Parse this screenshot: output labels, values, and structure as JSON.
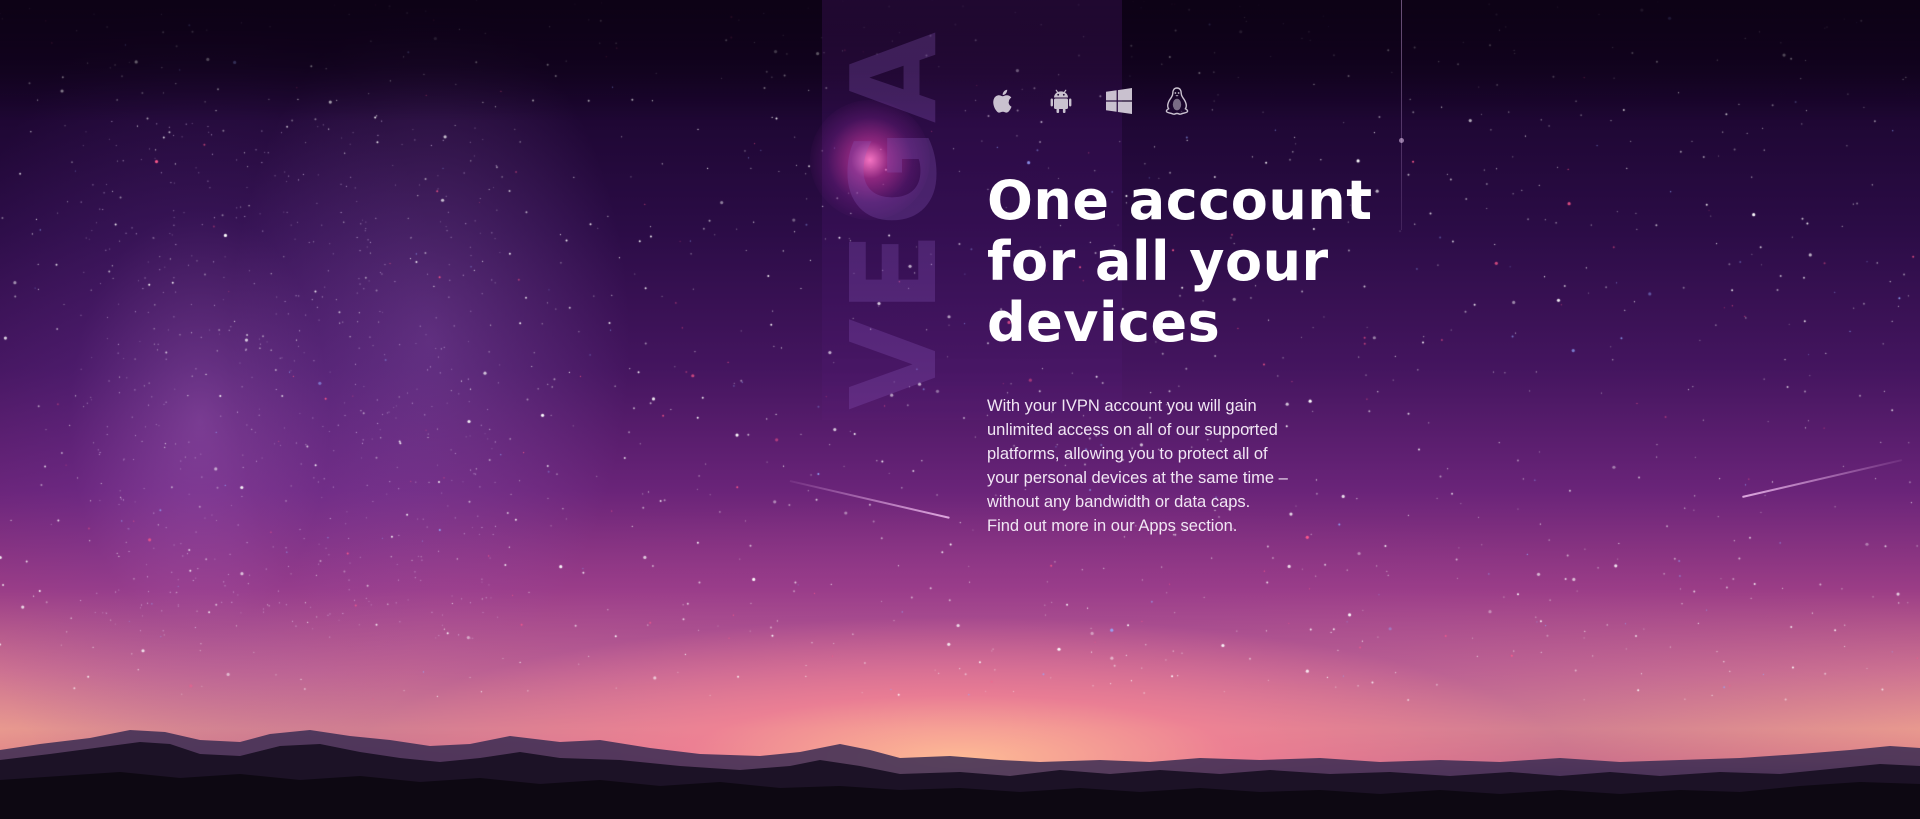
{
  "platforms": {
    "icons": [
      "apple-icon",
      "android-icon",
      "windows-icon",
      "linux-icon"
    ]
  },
  "hero": {
    "headline_lines": [
      "One account",
      "for all your",
      "devices"
    ],
    "description_lines": [
      "With your IVPN account you will gain",
      "unlimited access on all of our supported",
      "platforms, allowing you to protect all of",
      "your personal devices at the same time –",
      "without any bandwidth or data caps.",
      "Find out more in our Apps section."
    ]
  },
  "colors": {
    "headline": "#ffffff",
    "body_text": "#f1e6f4",
    "icon": "#c9c1cf",
    "sky_top": "#12031c",
    "horizon_glow": "#f0a28e"
  }
}
